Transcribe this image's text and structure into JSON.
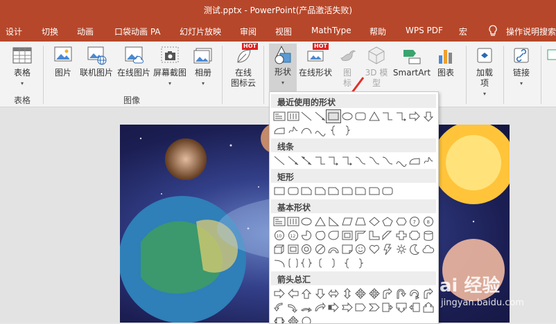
{
  "window": {
    "title": "测试.pptx  -  PowerPoint(产品激活失败)"
  },
  "tabs": [
    "设计",
    "切换",
    "动画",
    "口袋动画 PA",
    "幻灯片放映",
    "审阅",
    "视图",
    "MathType",
    "帮助",
    "WPS PDF",
    "宏",
    "操作说明搜索"
  ],
  "ribbon": {
    "table_label": "表格",
    "image_buttons": [
      "图片",
      "联机图片",
      "在线图片",
      "屏幕截图",
      "相册"
    ],
    "online_icon": "在线\n图标云",
    "shapes": "形状",
    "online_shapes": "在线形状",
    "icons": "图\n标",
    "model3d": "3D 模\n型",
    "smartart": "SmartArt",
    "chart": "图表",
    "addins": "加载\n项",
    "link": "链接",
    "groups": {
      "table": "表格",
      "images": "图像"
    },
    "hot_badge": "HOT"
  },
  "shapes_panel": {
    "sections": [
      "最近使用的形状",
      "线条",
      "矩形",
      "基本形状",
      "箭头总汇"
    ],
    "selected": "rectangle"
  },
  "watermark": {
    "brand": "Bai 经验",
    "url": "jingyan.baidu.com"
  },
  "colors": {
    "accent": "#b7472a",
    "ribbon_bg": "#f3f3f3",
    "arrow": "#e0302a"
  }
}
